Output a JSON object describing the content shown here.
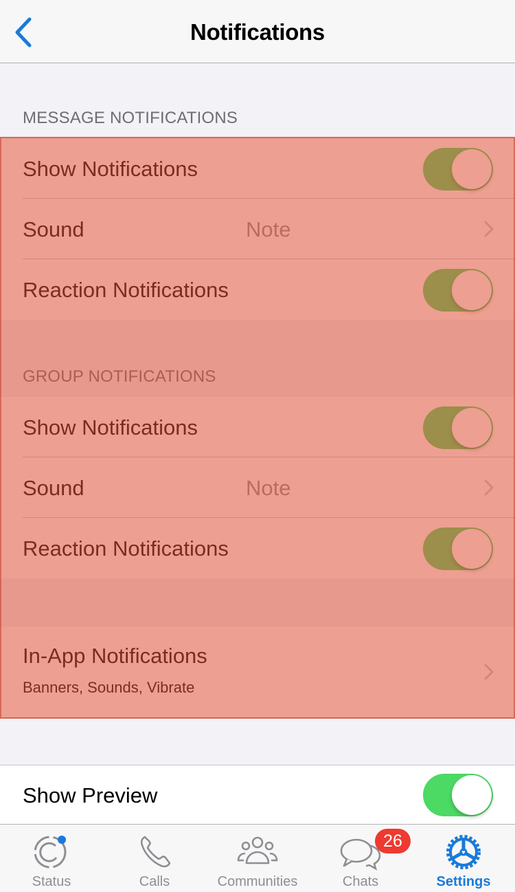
{
  "navbar": {
    "title": "Notifications",
    "back_icon": "chevron-left-icon"
  },
  "message_section": {
    "header": "MESSAGE NOTIFICATIONS",
    "rows": [
      {
        "label": "Show Notifications",
        "type": "toggle",
        "on": true
      },
      {
        "label": "Sound",
        "type": "disclosure",
        "value": "Note"
      },
      {
        "label": "Reaction Notifications",
        "type": "toggle",
        "on": true
      }
    ]
  },
  "group_section": {
    "header": "GROUP NOTIFICATIONS",
    "rows": [
      {
        "label": "Show Notifications",
        "type": "toggle",
        "on": true
      },
      {
        "label": "Sound",
        "type": "disclosure",
        "value": "Note"
      },
      {
        "label": "Reaction Notifications",
        "type": "toggle",
        "on": true
      }
    ]
  },
  "in_app": {
    "label": "In-App Notifications",
    "sublabel": "Banners, Sounds, Vibrate"
  },
  "preview": {
    "label": "Show Preview",
    "on": true
  },
  "tabbar": {
    "tabs": [
      {
        "label": "Status",
        "icon": "status-icon"
      },
      {
        "label": "Calls",
        "icon": "phone-icon"
      },
      {
        "label": "Communities",
        "icon": "communities-icon"
      },
      {
        "label": "Chats",
        "icon": "chats-icon",
        "badge": "26"
      },
      {
        "label": "Settings",
        "icon": "settings-gear-icon",
        "active": true
      }
    ]
  },
  "colors": {
    "accent": "#1a7ad9",
    "toggle_on": "#4cd964",
    "badge": "#ee3a30",
    "highlight_overlay": "#e9a08f"
  }
}
